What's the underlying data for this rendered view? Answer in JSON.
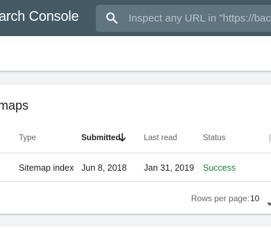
{
  "header": {
    "app_title": "arch Console",
    "search_placeholder": "Inspect any URL in \"https://backlinko"
  },
  "sitemaps_card": {
    "title": "maps",
    "columns": [
      {
        "label": "Type"
      },
      {
        "label": "Submitted",
        "sorted": "descending"
      },
      {
        "label": "Last read"
      },
      {
        "label": "Status"
      }
    ],
    "rows": [
      {
        "type": "Sitemap index",
        "submitted": "Jun 8, 2018",
        "last_read": "Jan 31, 2019",
        "status": "Success"
      }
    ],
    "footer": {
      "rows_per_page_label": "Rows per page:",
      "rows_per_page_value": "10"
    }
  },
  "icons": {
    "search": "search-icon",
    "sort": "arrow-down-icon",
    "dropdown": "triangle-down-icon"
  },
  "colors": {
    "header_bg": "#455a64",
    "search_bg": "#5f7580",
    "success": "#188038"
  }
}
